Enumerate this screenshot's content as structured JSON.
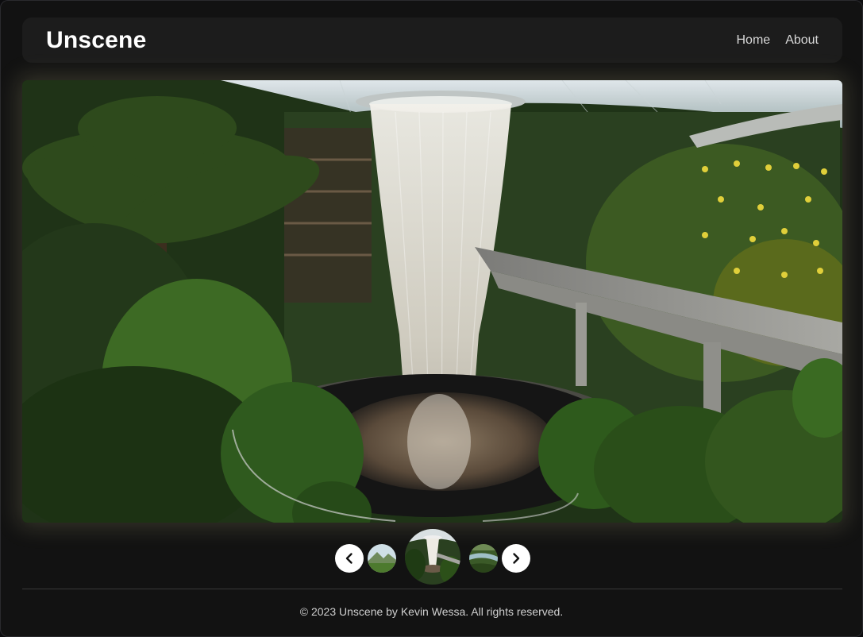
{
  "header": {
    "brand": "Unscene",
    "nav": [
      {
        "label": "Home"
      },
      {
        "label": "About"
      }
    ]
  },
  "hero": {
    "icon": "photo-waterfall"
  },
  "carousel": {
    "prev_icon": "chevron-left-icon",
    "next_icon": "chevron-right-icon",
    "thumbnails": [
      {
        "icon": "landscape-mountain",
        "active": false
      },
      {
        "icon": "landscape-waterfall",
        "active": true
      },
      {
        "icon": "landscape-river",
        "active": false
      }
    ]
  },
  "footer": {
    "text": "© 2023 Unscene by Kevin Wessa. All rights reserved."
  }
}
